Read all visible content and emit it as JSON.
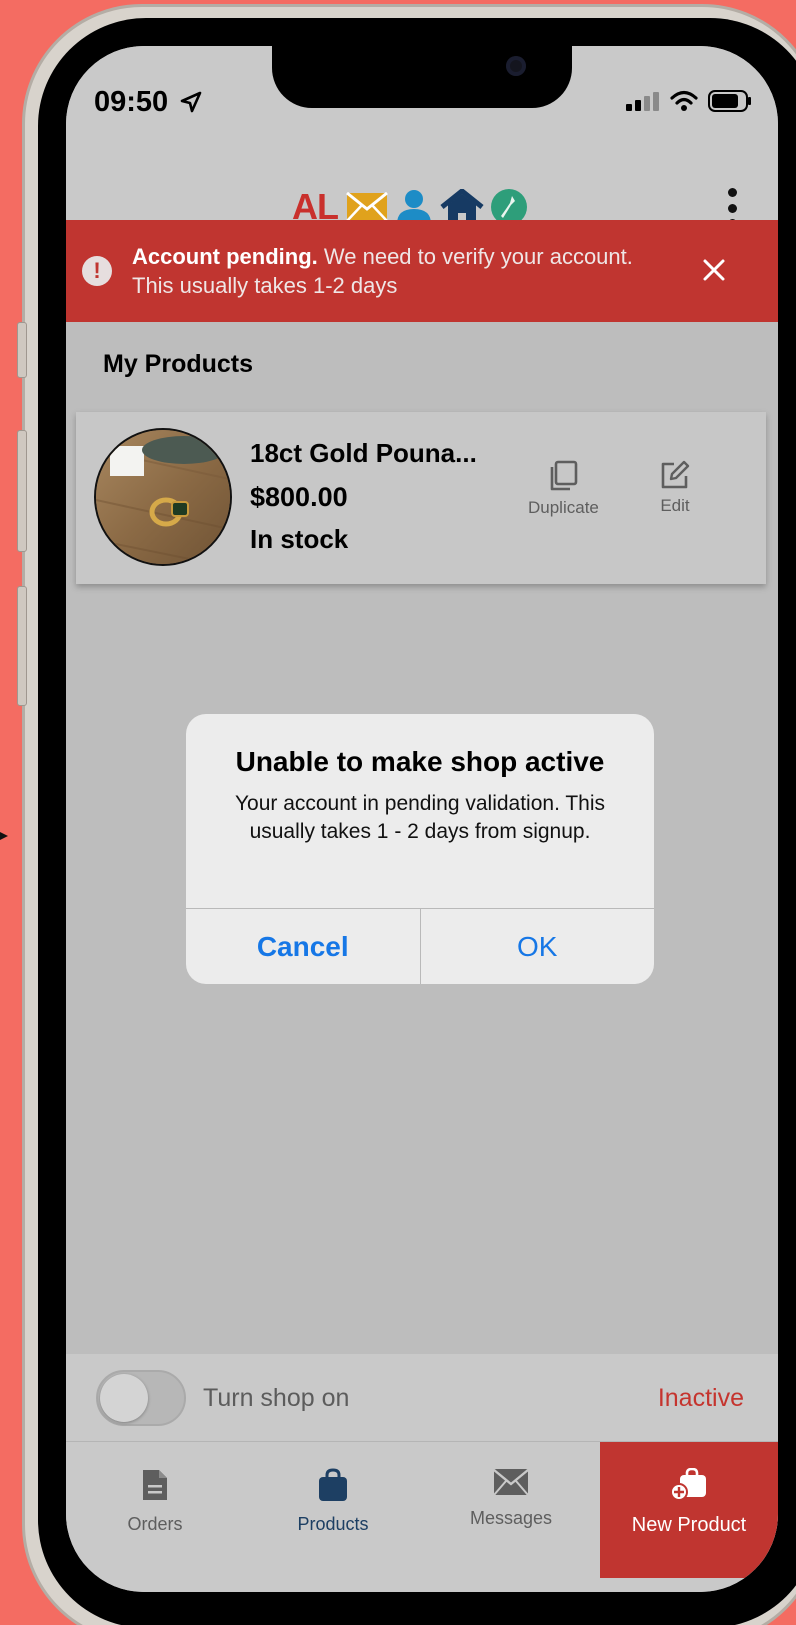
{
  "status_bar": {
    "time": "09:50"
  },
  "app_header": {
    "logo_text": "AL"
  },
  "banner": {
    "bold_text": "Account pending.",
    "message": "We need to verify your account. This usually takes 1-2 days"
  },
  "products_section": {
    "title": "My Products"
  },
  "products": [
    {
      "name": "18ct Gold Pouna...",
      "price": "$800.00",
      "stock": "In stock",
      "duplicate_label": "Duplicate",
      "edit_label": "Edit"
    }
  ],
  "dialog": {
    "title": "Unable to make shop active",
    "message": "Your account in pending validation. This usually takes 1 - 2 days from signup.",
    "cancel_label": "Cancel",
    "ok_label": "OK"
  },
  "shop_toggle": {
    "label": "Turn shop on",
    "status": "Inactive",
    "on": false
  },
  "tabs": [
    {
      "label": "Orders",
      "icon": "document-icon"
    },
    {
      "label": "Products",
      "icon": "shopping-bag-icon",
      "active": true
    },
    {
      "label": "Messages",
      "icon": "envelope-icon"
    },
    {
      "label": "New Product",
      "icon": "add-bag-icon"
    }
  ],
  "colors": {
    "banner_bg": "#c03530",
    "accent_blue": "#1677e6",
    "active_tab": "#1d3f63",
    "inactive_red": "#c5342e",
    "background": "#f46c62"
  }
}
